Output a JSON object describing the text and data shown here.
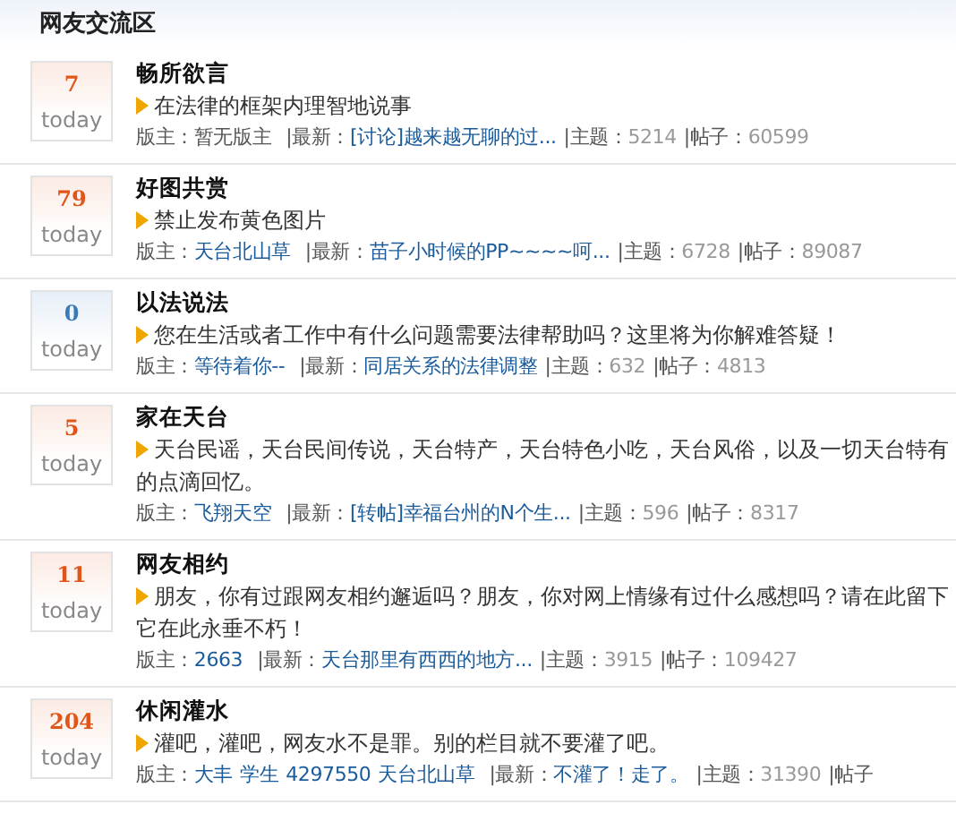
{
  "section_title": "网友交流区",
  "forums": [
    {
      "today_count": "7",
      "today_label": "today",
      "color": "#e0561a",
      "name": "畅所欲言",
      "description_lines": [
        "在法律的框架内理智地说事"
      ],
      "moderator_label": "版主：",
      "moderators": [
        {
          "name": "暂无版主",
          "linked": false
        }
      ],
      "latest_label": "|最新：",
      "latest": "[讨论]越来越无聊的过...",
      "topics_label": "|主题：",
      "topics": "5214",
      "posts_label": "|帖子：",
      "posts": "60599"
    },
    {
      "today_count": "79",
      "today_label": "today",
      "color": "#e0561a",
      "name": "好图共赏",
      "description_lines": [
        "禁止发布黄色图片"
      ],
      "moderator_label": "版主：",
      "moderators": [
        {
          "name": "天台北山草",
          "linked": true
        }
      ],
      "latest_label": "|最新：",
      "latest": "苗子小时候的PP~~~~呵...",
      "topics_label": "|主题：",
      "topics": "6728",
      "posts_label": "|帖子：",
      "posts": "89087"
    },
    {
      "today_count": "0",
      "today_label": "today",
      "color": "#3a7ab8",
      "name": "以法说法",
      "description_lines": [
        "您在生活或者工作中有什么问题需要法律帮助吗？这里将为你解难答疑！"
      ],
      "moderator_label": "版主：",
      "moderators": [
        {
          "name": "等待着你--",
          "linked": true
        }
      ],
      "latest_label": "|最新：",
      "latest": "同居关系的法律调整",
      "topics_label": "|主题：",
      "topics": "632",
      "posts_label": "|帖子：",
      "posts": "4813"
    },
    {
      "today_count": "5",
      "today_label": "today",
      "color": "#e0561a",
      "name": "家在天台",
      "description_lines": [
        "天台民谣，天台民间传说，天台特产，天台特色小吃，天台风俗，以及一切天台特有",
        "的点滴回忆。"
      ],
      "moderator_label": "版主：",
      "moderators": [
        {
          "name": "飞翔天空",
          "linked": true
        }
      ],
      "latest_label": "|最新：",
      "latest": "[转帖]幸福台州的N个生...",
      "topics_label": "|主题：",
      "topics": "596",
      "posts_label": "|帖子：",
      "posts": "8317"
    },
    {
      "today_count": "11",
      "today_label": "today",
      "color": "#e0561a",
      "name": "网友相约",
      "description_lines": [
        "朋友，你有过跟网友相约邂逅吗？朋友，你对网上情缘有过什么感想吗？请在此留下",
        "它在此永垂不朽！"
      ],
      "moderator_label": "版主：",
      "moderators": [
        {
          "name": "2663",
          "linked": true
        }
      ],
      "latest_label": "|最新：",
      "latest": "天台那里有西西的地方...",
      "topics_label": "|主题：",
      "topics": "3915",
      "posts_label": "|帖子：",
      "posts": "109427"
    },
    {
      "today_count": "204",
      "today_label": "today",
      "color": "#e0561a",
      "name": "休闲灌水",
      "description_lines": [
        "灌吧，灌吧，网友水不是罪。别的栏目就不要灌了吧。"
      ],
      "moderator_label": "版主：",
      "moderators": [
        {
          "name": "大丰",
          "linked": true
        },
        {
          "name": "学生",
          "linked": true
        },
        {
          "name": "4297550",
          "linked": true
        },
        {
          "name": "天台北山草",
          "linked": true
        }
      ],
      "latest_label": "|最新：",
      "latest": "不灌了！走了。",
      "topics_label": "|主题：",
      "topics": "31390",
      "posts_label": "|帖子"
    }
  ]
}
